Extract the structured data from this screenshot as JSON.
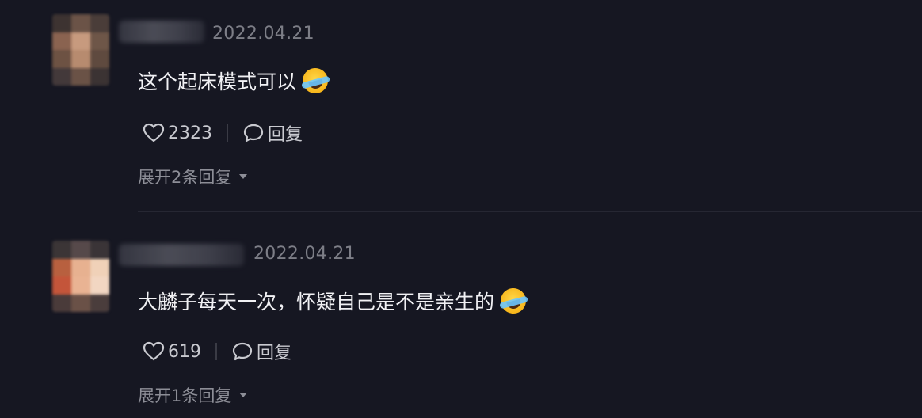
{
  "comments": [
    {
      "time": "2022.04.21",
      "text": "这个起床模式可以",
      "emoji": "rolling-laughing-emoji",
      "likes": "2323",
      "reply_label": "回复",
      "expand_label": "展开2条回复",
      "avatar_colors": [
        "#3d3331",
        "#6b5347",
        "#4a3d39",
        "#8a6350",
        "#c79a7e",
        "#6e5648",
        "#6d5243",
        "#b78b6f",
        "#5f4a3f",
        "#43393a",
        "#6a5246",
        "#3b3333"
      ]
    },
    {
      "time": "2022.04.21",
      "text": "大麟子每天一次，怀疑自己是不是亲生的",
      "emoji": "rolling-laughing-emoji",
      "likes": "619",
      "reply_label": "回复",
      "expand_label": "展开1条回复",
      "avatar_colors": [
        "#3b3536",
        "#56494a",
        "#3a3437",
        "#b8603f",
        "#e7b190",
        "#f0d1b8",
        "#c4553a",
        "#e9b393",
        "#f2d6c2",
        "#4a3b3a",
        "#6a5147",
        "#4a3d3c"
      ]
    }
  ]
}
